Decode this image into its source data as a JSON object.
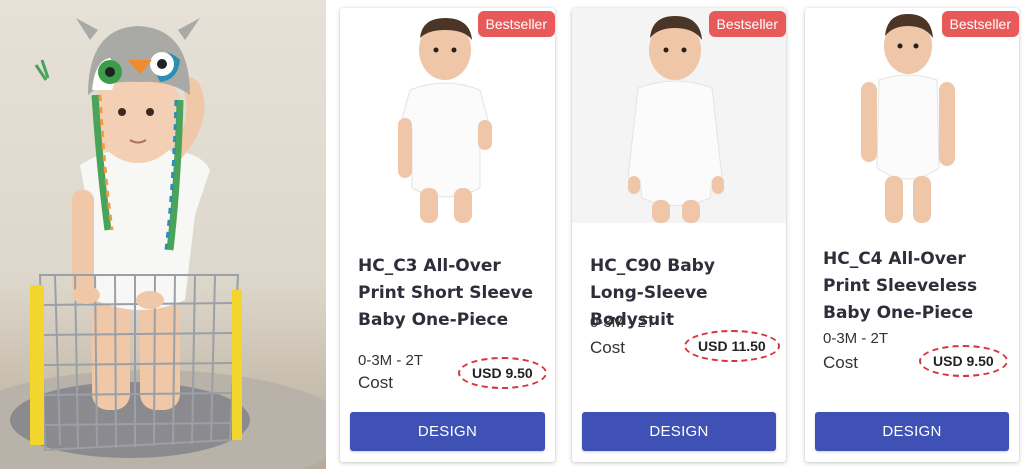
{
  "products": [
    {
      "badge": "Bestseller",
      "title": "HC_C3 All-Over Print Short Sleeve Baby One-Piece",
      "sizes": "0-3M - 2T",
      "cost_label": "Cost",
      "price": "USD 9.50",
      "button": "DESIGN"
    },
    {
      "badge": "Bestseller",
      "title": "HC_C90 Baby Long-Sleeve Bodysuit",
      "sizes": "0-3M - 2T",
      "cost_label": "Cost",
      "price": "USD 11.50",
      "button": "DESIGN"
    },
    {
      "badge": "Bestseller",
      "title": "HC_C4 All-Over Print Sleeveless Baby One-Piece",
      "sizes": "0-3M - 2T",
      "cost_label": "Cost",
      "price": "USD 9.50",
      "button": "DESIGN"
    }
  ],
  "colors": {
    "badge": "#e85a5a",
    "button": "#3f51b5",
    "price_ring": "#d9343a"
  }
}
